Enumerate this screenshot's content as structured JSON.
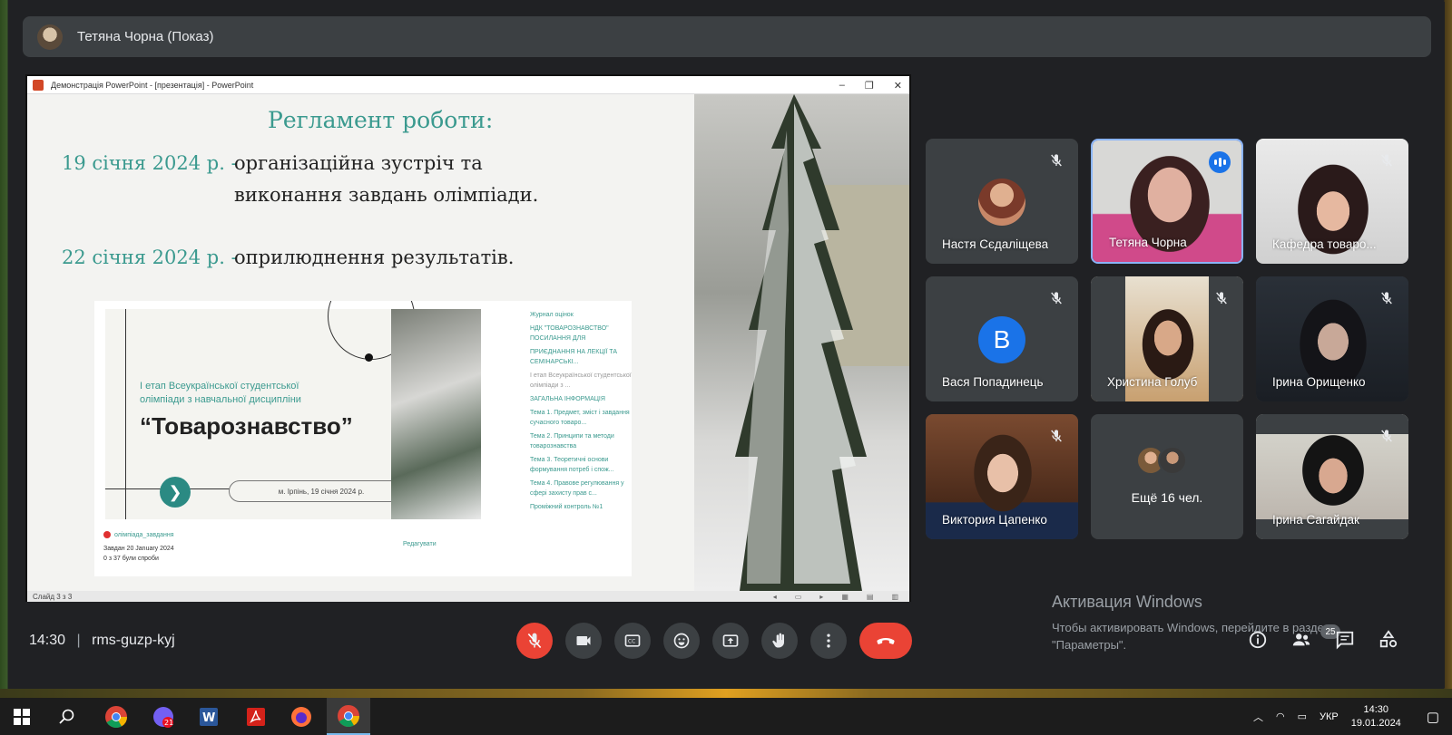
{
  "presenter": {
    "name": "Тетяна Чорна (Показ)"
  },
  "ppt": {
    "window_title": "Демонстрація PowerPoint - [презентація] - PowerPoint",
    "status": "Слайд 3 з 3"
  },
  "slide": {
    "title": "Регламент роботи:",
    "date1": "19 січня 2024 р. -",
    "text1a": "організаційна зустріч та",
    "text1b": "виконання завдань олімпіади.",
    "date2": "22 січня 2024 р. -",
    "text2": "оприлюднення результатів."
  },
  "embed": {
    "subtitle": "І етап Всеукраїнської студентської олімпіади з навчальної дисципліни",
    "main": "“Товарознавство”",
    "pill": "м. Ірпінь, 19 січня 2024 р.",
    "list": [
      "Журнал оцінок",
      "НДК \"ТОВАРОЗНАВСТВО\" ПОСИЛАННЯ ДЛЯ",
      "ПРИЄДНАННЯ НА ЛЕКЦІЇ ТА СЕМІНАРСЬКІ...",
      "І етап Всеукраїнської студентської олімпіади з ...",
      "ЗАГАЛЬНА ІНФОРМАЦІЯ",
      "Тема 1. Предмет, зміст і завдання сучасного товаро...",
      "Тема 2. Принципи та методи товарознавства",
      "Тема 3. Теоретичні основи формування потреб і спож...",
      "Тема 4. Правове регулювання у сфері захисту прав с...",
      "Проміжний контроль №1"
    ],
    "bottom_title": "олімпіада_завдання",
    "bottom_line2": "Завдан 20 January 2024",
    "bottom_line3": "0 з 37 були спроби",
    "edit": "Редагувати"
  },
  "participants": [
    {
      "name": "Настя Сєдаліщева",
      "muted": true,
      "kind": "photo-avatar"
    },
    {
      "name": "Тетяна Чорна",
      "muted": false,
      "speaking": true,
      "kind": "video"
    },
    {
      "name": "Кафедра товаро...",
      "muted": true,
      "kind": "video"
    },
    {
      "name": "Вася Попадинець",
      "muted": true,
      "kind": "letter",
      "letter": "В"
    },
    {
      "name": "Христина Голуб",
      "muted": true,
      "kind": "video"
    },
    {
      "name": "Ірина Орищенко",
      "muted": true,
      "kind": "video"
    },
    {
      "name": "Виктория Цапенко",
      "muted": true,
      "kind": "video"
    },
    {
      "name": "Ещё 16 чел.",
      "kind": "more"
    },
    {
      "name": "Ірина Сагайдак",
      "muted": true,
      "kind": "video"
    }
  ],
  "meeting": {
    "time": "14:30",
    "code": "rms-guzp-kyj",
    "participants_count": "25"
  },
  "windows_activation": {
    "title": "Активация Windows",
    "text": "Чтобы активировать Windows, перейдите в раздел \"Параметры\"."
  },
  "taskbar": {
    "time": "14:30",
    "date": "19.01.2024",
    "lang": "УКР"
  },
  "colors": {
    "accent_teal": "#3b9a8f",
    "end_call_red": "#ea4335",
    "active_blue": "#1a73e8"
  }
}
